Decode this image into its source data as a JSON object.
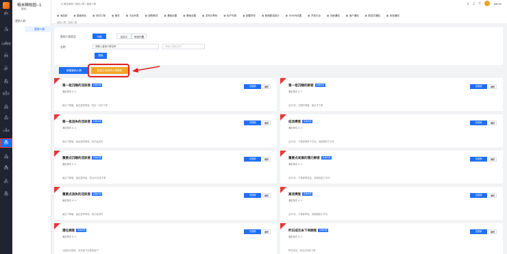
{
  "app": {
    "store_name": "榕米粮校园--1",
    "store_sub": "榕米..."
  },
  "left_nav": [
    {
      "label": "概况",
      "icon": "home-icon"
    },
    {
      "label": "订单",
      "icon": "order-icon"
    },
    {
      "label": "店铺管理",
      "icon": "store-icon"
    },
    {
      "label": "财务",
      "icon": "wallet-icon"
    },
    {
      "label": "用户",
      "icon": "user-icon"
    },
    {
      "label": "商品",
      "icon": "goods-icon"
    },
    {
      "label": "配送员",
      "icon": "rider-icon"
    },
    {
      "label": "运营",
      "icon": "chart-icon"
    },
    {
      "label": "活动",
      "icon": "gift-icon"
    },
    {
      "label": "小程序",
      "icon": "miniapp-icon"
    },
    {
      "label": "应用",
      "icon": "app-icon"
    },
    {
      "label": "设置",
      "icon": "gear-icon"
    },
    {
      "label": "权限",
      "icon": "lock-icon"
    },
    {
      "label": "统计",
      "icon": "stats-icon"
    },
    {
      "label": "系统",
      "icon": "system-icon"
    }
  ],
  "sub_nav": {
    "section": "营销人群",
    "item": "营销人群"
  },
  "topbar": {
    "breadcrumb": "⊞ 概览管理  /  营销人群  /  营销人群",
    "icons": [
      "search-icon",
      "bell-icon",
      "help-icon"
    ],
    "user": "admin"
  },
  "quick_nav": [
    "添加券",
    "集客转化",
    "待付订单",
    "服务",
    "平台列表",
    "团购概况",
    "基础设置",
    "基础设置",
    "发布分享码",
    "用户列表",
    "配置学校",
    "新增配送统计",
    "UNION设置",
    "开放平台",
    "页面通知",
    "用户通知",
    "配送员通知",
    "系统通知"
  ],
  "crumb2": "营销人群 / 营销人群",
  "filter": {
    "type_label": "营销人群类型",
    "types": [
      "不限",
      "自定义",
      "系统内置"
    ],
    "name_label": "名称",
    "name_value": "请输入营销人群名称",
    "name_placeholder": "请输入搜索名称",
    "search_label": "搜索"
  },
  "actions": {
    "add": "新建营销人群",
    "quick": "批量生成营销人群模板"
  },
  "cards": [
    {
      "title": "第一批沉睡的活跃客",
      "tag": "系统内置",
      "count": "满足条件 0 人",
      "desc": "最近下单客，最近复购率高，但近一月未下单",
      "go": "去营销",
      "edit": "编辑"
    },
    {
      "title": "第一批沉睡的新客",
      "tag": "系统内置",
      "count": "满足条件 0 人",
      "desc": "近30天，注册时间新，最近未下单",
      "go": "去营销",
      "edit": "编辑"
    },
    {
      "title": "第一批流失的活跃客",
      "tag": "系统内置",
      "count": "满足条件 0 人",
      "desc": "最近下单客，最近复购率高，但已经流失",
      "go": "去营销",
      "edit": "编辑"
    },
    {
      "title": "低消费客",
      "tag": "系统内置",
      "count": "满足条件 0 人",
      "desc": "近30天，下单频率低于平均，消费额低于平均",
      "go": "去营销",
      "edit": "编辑"
    },
    {
      "title": "重要点沉睡的活跃客",
      "tag": "系统内置",
      "count": "满足条件 0 人",
      "desc": "最近下单客，最近复购高，但近30天未下单",
      "go": "去营销",
      "edit": "编辑"
    },
    {
      "title": "重要点发展的潜力顾客",
      "tag": "系统内置",
      "count": "满足条件 0 人",
      "desc": "近30天，下单频率较高，消费较高于平均",
      "go": "去营销",
      "edit": "编辑"
    },
    {
      "title": "重要点流失的活跃客",
      "tag": "系统内置",
      "count": "满足条件 0 人",
      "desc": "最近下单客，最近复购率高，但已经流失",
      "go": "去营销",
      "edit": "编辑"
    },
    {
      "title": "高消费客",
      "tag": "系统内置",
      "count": "满足条件 0 人",
      "desc": "近30天，下单频率高，消费额高于平均",
      "go": "去营销",
      "edit": "编辑"
    },
    {
      "title": "潜在顾客",
      "tag": "系统内置",
      "count": "满足条件 0 人",
      "desc": "注册后已授权，但未曾下过单的用户",
      "go": "去营销",
      "edit": "编辑"
    },
    {
      "title": "昨日成交未下单顾客",
      "tag": "系统内置",
      "count": "满足条件 0 人",
      "desc": "昨天成交，但今日尚未下单",
      "go": "去营销",
      "edit": "编辑"
    }
  ]
}
